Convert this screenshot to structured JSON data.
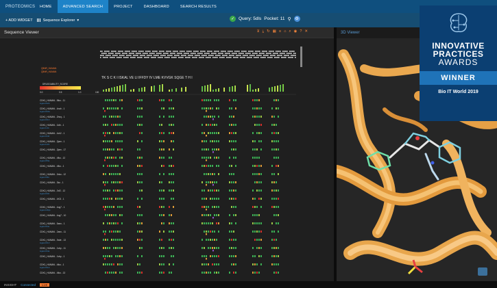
{
  "nav": {
    "logo_text": "PROTEOMICS",
    "tabs": [
      {
        "label": "HOME",
        "active": false
      },
      {
        "label": "ADVANCED SEARCH",
        "active": true
      },
      {
        "label": "PROJECT",
        "active": false
      },
      {
        "label": "DASHBOARD",
        "active": false
      },
      {
        "label": "SEARCH RESULTS",
        "active": false
      }
    ]
  },
  "toolbar": {
    "add_widget": "+ ADD WIDGET",
    "widget_select": "Sequence Explorer",
    "query_label": "Query: 5dls",
    "pocket_label": "Pocket: 11"
  },
  "sequence_viewer": {
    "title": "Sequence Viewer",
    "legend_title": "DRUGGABILITY_SCORE",
    "legend_ticks": [
      "0.0",
      "0.5",
      "1.0"
    ],
    "legend_max": "100",
    "query_row": [
      "Q5NR_HUMAN",
      "Q5NR_HUMAN"
    ],
    "sequence_letters": "TK  S  C     K  I     ISKAL  VE     LI     IFFDY  IV     LME          KVVGK          SQGE     T    H   I",
    "rows": [
      {
        "name": "CDK1_HUMAN - 5tko - 11",
        "sub": "Ligand K2A"
      },
      {
        "name": "CDK1_HUMAN - 4ncb - 1",
        "sub": "Ligand K3G"
      },
      {
        "name": "CDK1_HUMAN - 2hnq - 1",
        "sub": "Ligand K1V"
      },
      {
        "name": "CDK1_HUMAN - 1idh - 1",
        "sub": "Ligand LIG"
      },
      {
        "name": "CDK1_HUMAN - 4ch2 - 1",
        "sub": "Ligand K40"
      },
      {
        "name": "CDK1_HUMAN - 2jam - 1",
        "sub": "Ligand LZ3"
      },
      {
        "name": "CDK1_HUMAN - 2jam - 17",
        "sub": ""
      },
      {
        "name": "CDK1_HUMAN - 4fko - 12",
        "sub": "Ligand P0a"
      },
      {
        "name": "CDK1_HUMAN - 4fko - 1",
        "sub": ""
      },
      {
        "name": "CDK1_HUMAN - 3nko - 12",
        "sub": "Ligand 9Fo"
      },
      {
        "name": "CDK1_HUMAN - 3ko - 1",
        "sub": ""
      },
      {
        "name": "CDK2_HUMAN - 2vf2 - 12",
        "sub": "Ligand F40"
      },
      {
        "name": "CDK1_HUMAN - 4KD - 1",
        "sub": ""
      },
      {
        "name": "CDK1_HUMAN - 4og7 - 1",
        "sub": "Ligand 2Dy1"
      },
      {
        "name": "CDK1_HUMAN - 4og7 - 10",
        "sub": ""
      },
      {
        "name": "CDK1_HUMAN - 5aeo - 1",
        "sub": "Ligand K4e"
      },
      {
        "name": "CDK1_HUMAN - 2aeo - 11",
        "sub": ""
      },
      {
        "name": "CDK1_HUMAN - 3wte - 13",
        "sub": "Ligand K1V"
      },
      {
        "name": "CDK1_HUMAN - 1vbp - 11",
        "sub": "Ligand K4a"
      },
      {
        "name": "CDK1_HUMAN - 1vbp - 1",
        "sub": ""
      },
      {
        "name": "CDK1_HUMAN - 4tko - 1",
        "sub": "Ligand K1A"
      },
      {
        "name": "CDK1_HUMAN - 4tko - 13",
        "sub": ""
      }
    ]
  },
  "viewer3d": {
    "title": "3D Viewer"
  },
  "award": {
    "line1": "INNOVATIVE",
    "line2": "PRACTICES",
    "line3": "AWARDS",
    "winner": "WINNER",
    "event": "Bio IT World 2019"
  },
  "status": {
    "label": "INSIGHT",
    "item1": "Connected",
    "item2": "Live"
  },
  "colors": {
    "nav_bg": "#0f4f7e",
    "nav_active": "#1e83c8",
    "toolbar_bg": "#164d72",
    "accent_orange": "#ff7a2f",
    "protein": "#f2b35a",
    "ligand": "#7fd0e0",
    "award_bg": "#0b3f72"
  }
}
